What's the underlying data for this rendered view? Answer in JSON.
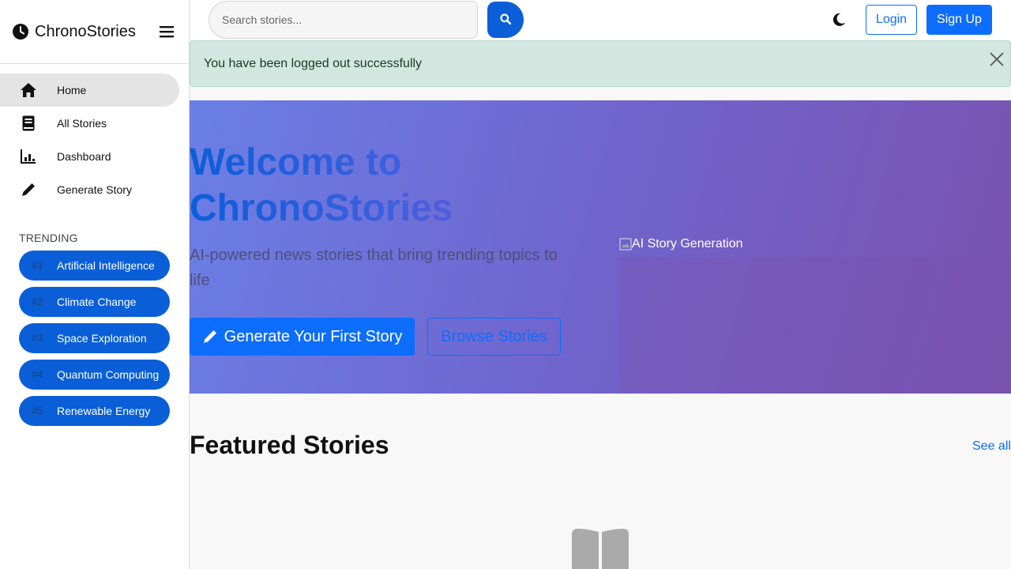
{
  "brand": {
    "name": "ChronoStories",
    "logo_icon": "clock-icon",
    "menu_icon": "hamburger-icon"
  },
  "nav": {
    "items": [
      {
        "label": "Home",
        "icon": "home-icon",
        "active": true
      },
      {
        "label": "All Stories",
        "icon": "book-icon",
        "active": false
      },
      {
        "label": "Dashboard",
        "icon": "chart-icon",
        "active": false
      },
      {
        "label": "Generate Story",
        "icon": "pen-icon",
        "active": false
      }
    ]
  },
  "trending": {
    "title": "TRENDING",
    "items": [
      {
        "rank": "#1",
        "label": "Artificial Intelligence"
      },
      {
        "rank": "#2",
        "label": "Climate Change"
      },
      {
        "rank": "#3",
        "label": "Space Exploration"
      },
      {
        "rank": "#4",
        "label": "Quantum Computing"
      },
      {
        "rank": "#5",
        "label": "Renewable Energy"
      }
    ]
  },
  "topbar": {
    "search_placeholder": "Search stories...",
    "search_value": "",
    "search_icon": "search-icon",
    "theme_icon": "moon-icon",
    "login_label": "Login",
    "signup_label": "Sign Up"
  },
  "alert": {
    "message": "You have been logged out successfully",
    "close_icon": "close-icon"
  },
  "hero": {
    "title": "Welcome to ChronoStories",
    "subtitle": "AI-powered news stories that bring trending topics to life",
    "primary_button": "Generate Your First Story",
    "primary_icon": "pen-icon",
    "secondary_button": "Browse Stories",
    "image_alt": "AI Story Generation"
  },
  "featured": {
    "title": "Featured Stories",
    "see_all": "See all",
    "empty_icon": "open-book-icon"
  },
  "colors": {
    "primary": "#0d6efd",
    "trend_pill": "#0a5fd8",
    "alert_bg": "#d2e7df",
    "hero_start": "#6a7fe6",
    "hero_end": "#7a52b0"
  }
}
